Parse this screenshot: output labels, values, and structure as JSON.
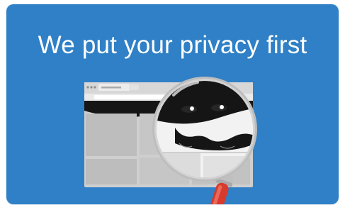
{
  "hero": {
    "headline": "We put your privacy first"
  },
  "colors": {
    "card_background": "#2f80c6",
    "headline_text": "#ffffff",
    "browser_frame": "#c9c9c9",
    "browser_panel": "#b9b9b9",
    "magnifier_rim": "#bdbdbd",
    "magnifier_handle": "#d83a2c",
    "mask_band": "#151515"
  },
  "icons": {
    "magnifier": "magnifying-glass-icon",
    "browser": "browser-window-icon",
    "mask": "burglar-mask-icon"
  }
}
